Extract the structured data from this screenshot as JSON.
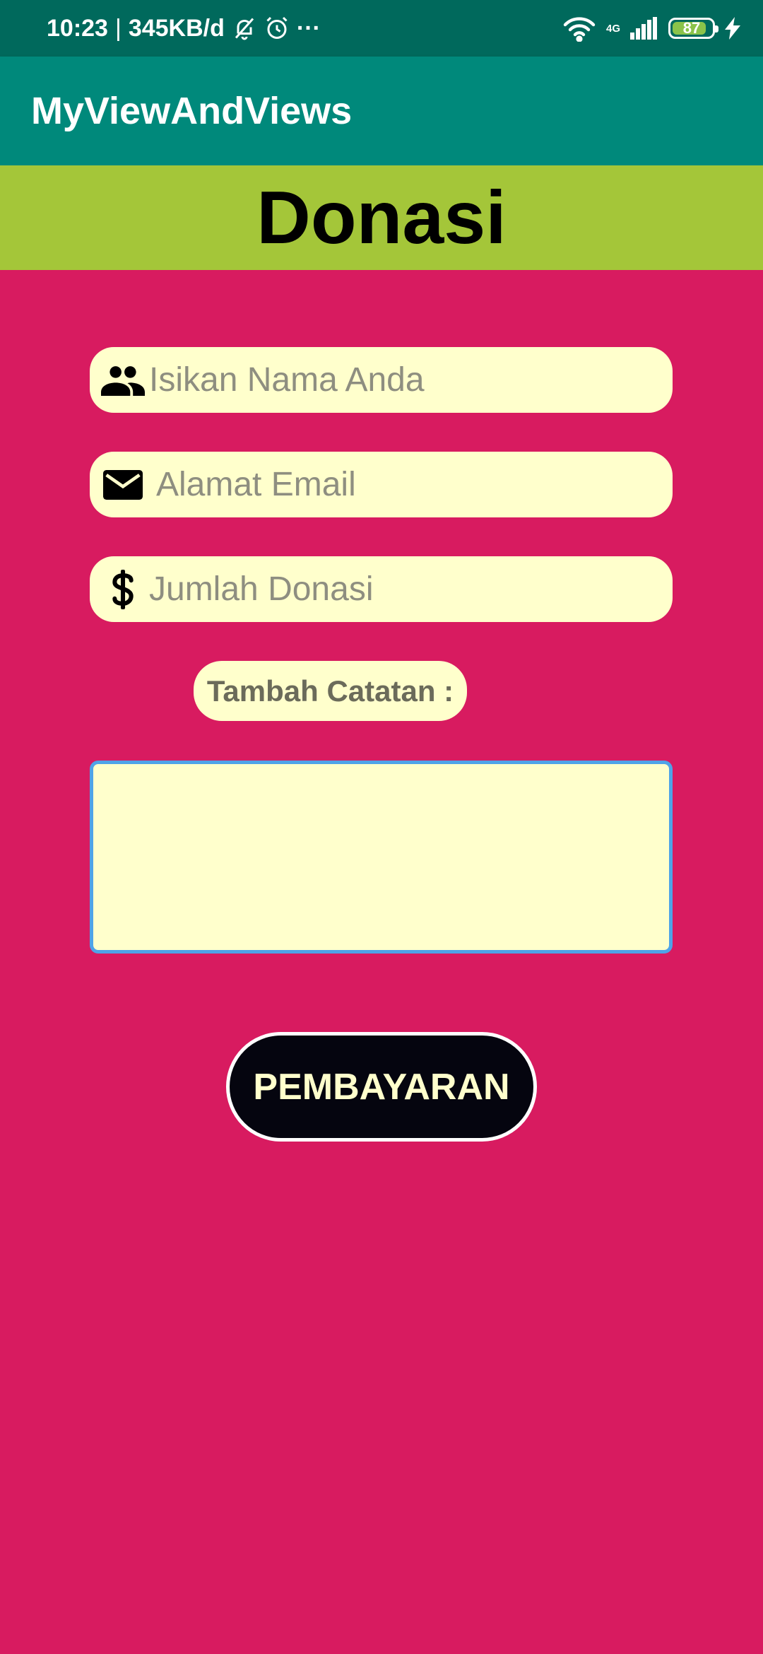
{
  "status_bar": {
    "time": "10:23",
    "separator": "|",
    "network_speed": "345KB/d",
    "more": "···",
    "network_type": "4G",
    "battery_level": "87",
    "battery_fraction": 0.87,
    "icons": [
      "muted-bell-icon",
      "alarm-clock-icon",
      "wifi-icon",
      "signal-icon",
      "battery-icon",
      "charging-bolt-icon"
    ]
  },
  "app_bar": {
    "title": "MyViewAndViews"
  },
  "header": {
    "title": "Donasi"
  },
  "form": {
    "name_placeholder": "Isikan Nama Anda",
    "email_placeholder": "Alamat Email",
    "amount_placeholder": "Jumlah Donasi",
    "note_label": "Tambah Catatan :",
    "note_value": "",
    "icons": {
      "name": "people-icon",
      "email": "mail-icon",
      "amount": "dollar-icon"
    }
  },
  "actions": {
    "pay_label": "PEMBAYARAN"
  },
  "colors": {
    "status_bar": "#00695C",
    "app_bar": "#00897B",
    "header_band": "#A4C639",
    "background": "#D81B60",
    "field_bg": "#FFFFCC",
    "button_bg": "#05050F",
    "button_text": "#FFFFCC",
    "focus_border": "#4FA3E8"
  }
}
